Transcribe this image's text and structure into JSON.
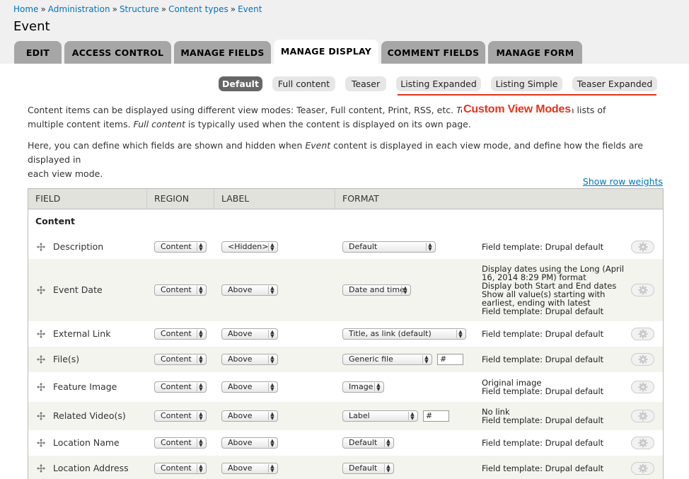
{
  "breadcrumb": [
    {
      "label": "Home"
    },
    {
      "label": "Administration"
    },
    {
      "label": "Structure"
    },
    {
      "label": "Content types"
    },
    {
      "label": "Event"
    }
  ],
  "breadcrumb_separator": "»",
  "page_title": "Event",
  "tabs": [
    "EDIT",
    "ACCESS CONTROL",
    "MANAGE FIELDS",
    "MANAGE DISPLAY",
    "COMMENT FIELDS",
    "MANAGE FORM"
  ],
  "active_tab": "MANAGE DISPLAY",
  "view_modes": [
    "Default",
    "Full content",
    "Teaser",
    "Listing Expanded",
    "Listing Simple",
    "Teaser Expanded"
  ],
  "active_view_mode": "Default",
  "annotation": "Custom View Modes",
  "intro": {
    "p1_a": "Content items can be displayed using different view modes: Teaser, Full content, Print, RSS, etc. ",
    "p1_b": "Teaser",
    "p1_c": " is generally used in lists of",
    "p1_d": "multiple content items. ",
    "p1_e": "Full content",
    "p1_f": " is typically used when the content is displayed on its own page.",
    "p2_a": "Here, you can define which fields are shown and hidden when ",
    "p2_b": "Event",
    "p2_c": " content is displayed in each view mode, and define how the fields are displayed in",
    "p2_d": "each view mode."
  },
  "show_row_weights": "Show row weights",
  "table": {
    "headers": [
      "FIELD",
      "REGION",
      "LABEL",
      "FORMAT"
    ],
    "section": "Content",
    "rows": [
      {
        "field": "Description",
        "region": "Content",
        "label": "<Hidden>",
        "format": "Default",
        "extra": "",
        "summary": [
          "Field template: Drupal default"
        ]
      },
      {
        "field": "Event Date",
        "region": "Content",
        "label": "Above",
        "format": "Date and time",
        "extra": "",
        "summary": [
          "Display dates using the Long (April",
          "16, 2014 8:29 PM) format",
          "Display both Start and End dates",
          "Show all value(s) starting with",
          "earliest, ending with latest",
          "Field template: Drupal default"
        ]
      },
      {
        "field": "External Link",
        "region": "Content",
        "label": "Above",
        "format": "Title, as link (default)",
        "extra": "",
        "summary": [
          "Field template: Drupal default"
        ]
      },
      {
        "field": "File(s)",
        "region": "Content",
        "label": "Above",
        "format": "Generic file",
        "extra": "#",
        "summary": [
          "Field template: Drupal default"
        ]
      },
      {
        "field": "Feature Image",
        "region": "Content",
        "label": "Above",
        "format": "Image",
        "extra": "",
        "summary": [
          "Original image",
          "Field template: Drupal default"
        ]
      },
      {
        "field": "Related Video(s)",
        "region": "Content",
        "label": "Above",
        "format": "Label",
        "extra": "#",
        "summary": [
          "No link",
          "Field template: Drupal default"
        ]
      },
      {
        "field": "Location Name",
        "region": "Content",
        "label": "Above",
        "format": "Default",
        "extra": "",
        "summary": [
          "Field template: Drupal default"
        ]
      },
      {
        "field": "Location Address",
        "region": "Content",
        "label": "Above",
        "format": "Default",
        "extra": "",
        "summary": [
          "Field template: Drupal default"
        ]
      }
    ]
  },
  "colors": {
    "link": "#0074bd",
    "annotation": "#e8321a",
    "tab_bg": "#a6a6a6",
    "active_pill": "#666666"
  }
}
